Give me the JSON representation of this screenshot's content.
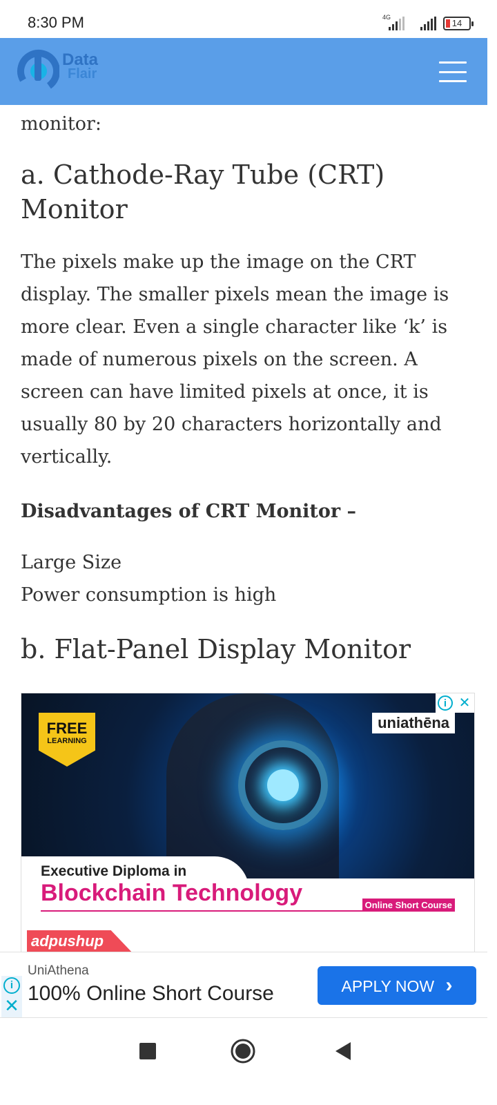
{
  "status": {
    "time": "8:30 PM",
    "network": "4G",
    "battery": "14"
  },
  "header": {
    "logo_line1": "Data",
    "logo_line2": "Flair"
  },
  "article": {
    "fragment": "monitor:",
    "heading_a": "a. Cathode-Ray Tube (CRT) Monitor",
    "paragraph": "The pixels make up the image on the CRT display. The smaller pixels mean the image is more clear. Even a single character like ‘k’ is made of numerous pixels on the screen. A screen can have limited pixels at once, it is usually 80 by 20 characters horizontally and vertically.",
    "disadvantages_heading": "Disadvantages of CRT Monitor –",
    "disadvantages": [
      "Large Size",
      "Power consumption is high"
    ],
    "heading_b": "b. Flat-Panel Display Monitor"
  },
  "ad": {
    "badge_line1": "FREE",
    "badge_line2": "LEARNING",
    "brand": "uniathēna",
    "title_line1": "Executive Diploma in",
    "title_line2": "Blockchain Technology",
    "tag": "Online Short Course",
    "network": "adpushup",
    "close_glyph": "✕",
    "info_glyph": "i"
  },
  "sticky_ad": {
    "advertiser": "UniAthena",
    "headline": "100% Online Short Course",
    "cta": "APPLY NOW",
    "cta_icon": "›"
  },
  "colors": {
    "header_bg": "#5a9ee8",
    "cta_bg": "#1a73e8",
    "ad_accent": "#d81b7a"
  }
}
